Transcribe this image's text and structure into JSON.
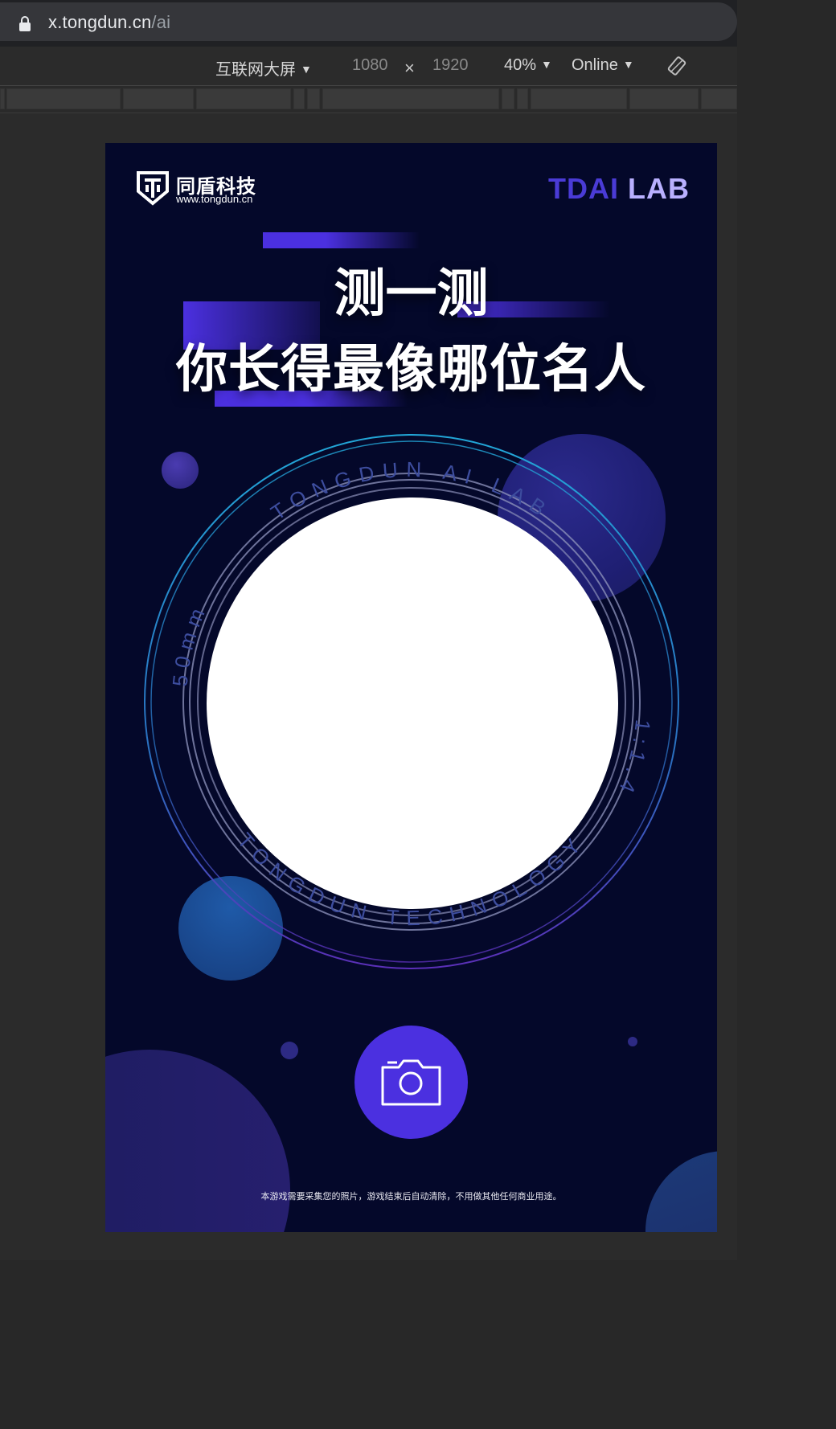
{
  "browser": {
    "url_host": "x.tongdun.cn",
    "url_path": "/ai",
    "lock_icon": "lock-icon"
  },
  "device_toolbar": {
    "device": "互联网大屏",
    "width": "1080",
    "times": "×",
    "height": "1920",
    "zoom": "40%",
    "network": "Online",
    "rotate_icon": "rotate-icon"
  },
  "poster": {
    "logo_cn": "同盾科技",
    "logo_url": "www.tongdun.cn",
    "lab_part1": "TDAI",
    "lab_part2": " LAB",
    "title_line1": "测一测",
    "title_line2": "你长得最像哪位名人",
    "ring_top": "TONGDUN AI LAB",
    "ring_left": "50mm",
    "ring_right": "1:1.4",
    "ring_bottom": "TONGDUN TECHNOLOGY",
    "camera_icon": "camera-icon",
    "disclaimer": "本游戏需要采集您的照片，游戏结束后自动清除，不用做其他任何商业用途。"
  },
  "colors": {
    "poster_bg": "#04082a",
    "accent_purple": "#4b30e0",
    "lab_light": "#b9b0ff",
    "ring_cyan": "#22a7d8",
    "ring_violet": "#5b2fb8",
    "ring_text": "#3a4a9a"
  }
}
